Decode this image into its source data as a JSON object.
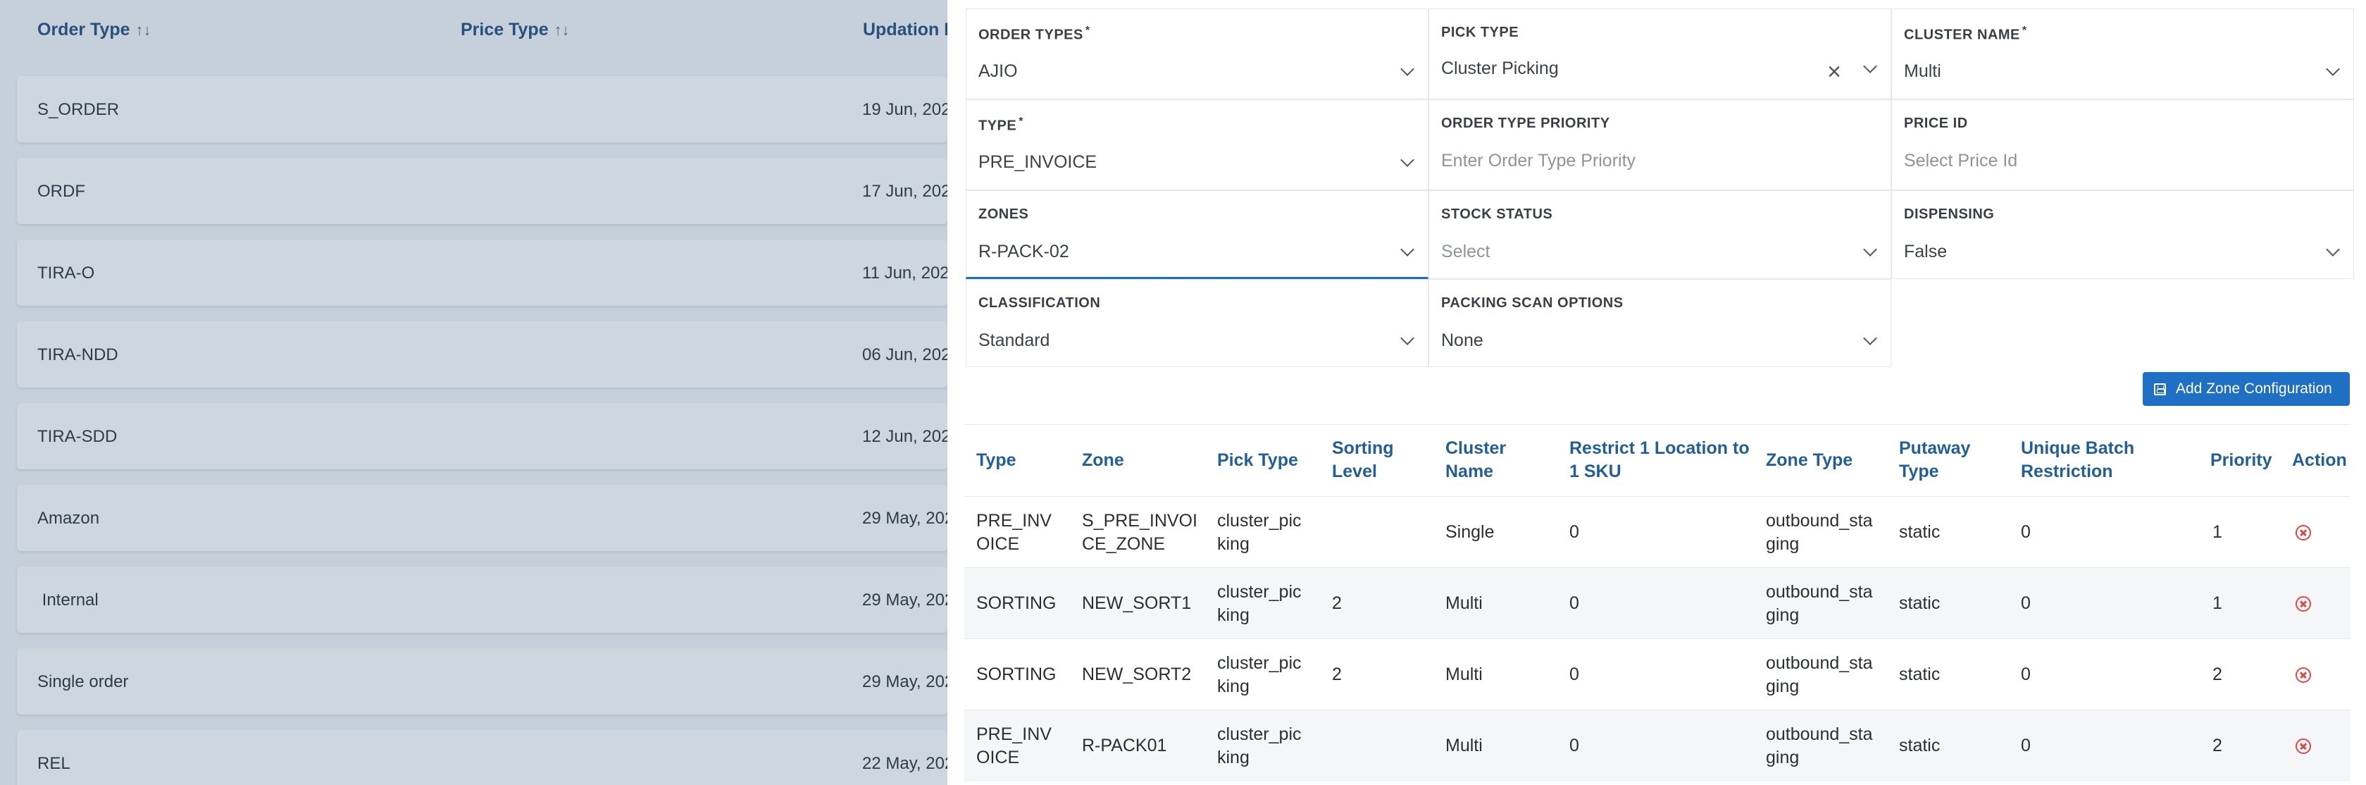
{
  "background_list": {
    "columns": [
      {
        "label": "Order Type",
        "sort_icon": "↑↓"
      },
      {
        "label": "Price Type",
        "sort_icon": "↑↓"
      },
      {
        "label": "Updation D"
      }
    ],
    "rows": [
      {
        "order_type": "S_ORDER",
        "date": "19 Jun, 202"
      },
      {
        "order_type": "ORDF",
        "date": "17 Jun, 202"
      },
      {
        "order_type": "TIRA-O",
        "date": "11 Jun, 202"
      },
      {
        "order_type": "TIRA-NDD",
        "date": "06 Jun, 202"
      },
      {
        "order_type": "TIRA-SDD",
        "date": "12 Jun, 202"
      },
      {
        "order_type": "Amazon",
        "date": "29 May, 202"
      },
      {
        "order_type": " Internal",
        "date": "29 May, 202"
      },
      {
        "order_type": "Single order",
        "date": "29 May, 202"
      },
      {
        "order_type": "REL",
        "date": "22 May, 202"
      }
    ]
  },
  "form": {
    "order_types": {
      "label": "ORDER TYPES",
      "required": "*",
      "value": "AJIO"
    },
    "pick_type": {
      "label": "PICK TYPE",
      "value": "Cluster Picking",
      "clear": "×"
    },
    "cluster_name": {
      "label": "CLUSTER NAME",
      "required": "*",
      "value": "Multi"
    },
    "type": {
      "label": "TYPE",
      "required": "*",
      "value": "PRE_INVOICE"
    },
    "order_type_priority": {
      "label": "ORDER TYPE PRIORITY",
      "placeholder": "Enter Order Type Priority"
    },
    "price_id": {
      "label": "PRICE ID",
      "placeholder": "Select Price Id"
    },
    "zones": {
      "label": "ZONES",
      "value": "R-PACK-02"
    },
    "stock_status": {
      "label": "STOCK STATUS",
      "placeholder": "Select"
    },
    "dispensing": {
      "label": "DISPENSING",
      "value": "False"
    },
    "classification": {
      "label": "CLASSIFICATION",
      "value": "Standard"
    },
    "packing_scan_options": {
      "label": "PACKING SCAN OPTIONS",
      "value": "None"
    }
  },
  "add_zone_button": {
    "label": "Add Zone Configuration",
    "icon": "save-icon"
  },
  "zone_table": {
    "headers": {
      "type": "Type",
      "zone": "Zone",
      "pick_type": "Pick Type",
      "sorting_level": "Sorting Level",
      "cluster_name": "Cluster Name",
      "restrict": "Restrict 1 Location to 1 SKU",
      "zone_type": "Zone Type",
      "putaway_type": "Putaway Type",
      "unique_batch": "Unique Batch Restriction",
      "priority": "Priority",
      "action": "Action"
    },
    "rows": [
      {
        "type": "PRE_INVOICE",
        "zone": "S_PRE_INVOICE_ZONE",
        "pick_type": "cluster_picking",
        "sorting_level": "",
        "cluster_name": "Single",
        "restrict": "0",
        "zone_type": "outbound_staging",
        "putaway_type": "static",
        "unique_batch": "0",
        "priority": "1"
      },
      {
        "type": "SORTING",
        "zone": "NEW_SORT1",
        "pick_type": "cluster_picking",
        "sorting_level": "2",
        "cluster_name": "Multi",
        "restrict": "0",
        "zone_type": "outbound_staging",
        "putaway_type": "static",
        "unique_batch": "0",
        "priority": "1"
      },
      {
        "type": "SORTING",
        "zone": "NEW_SORT2",
        "pick_type": "cluster_picking",
        "sorting_level": "2",
        "cluster_name": "Multi",
        "restrict": "0",
        "zone_type": "outbound_staging",
        "putaway_type": "static",
        "unique_batch": "0",
        "priority": "2"
      },
      {
        "type": "PRE_INVOICE",
        "zone": "R-PACK01",
        "pick_type": "cluster_picking",
        "sorting_level": "",
        "cluster_name": "Multi",
        "restrict": "0",
        "zone_type": "outbound_staging",
        "putaway_type": "static",
        "unique_batch": "0",
        "priority": "2"
      }
    ]
  },
  "colors": {
    "accent": "#1f6fc5",
    "header_text": "#235f95",
    "delete": "#e04848",
    "overlay": "#c6d0da"
  }
}
